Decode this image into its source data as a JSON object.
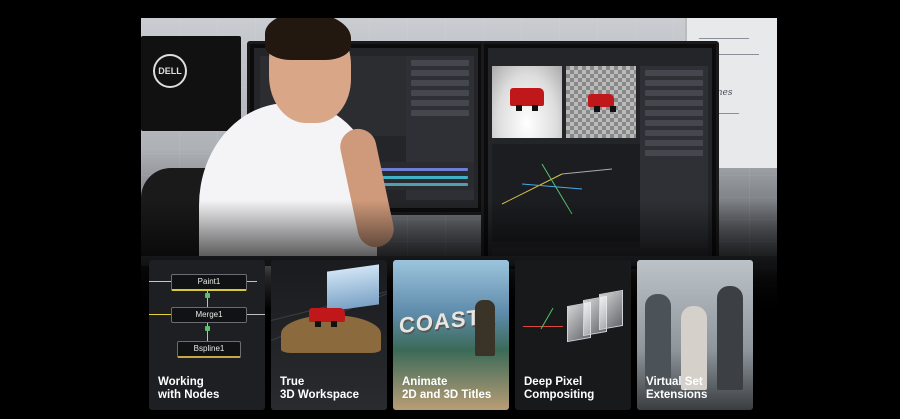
{
  "hero": {
    "monitor_brand": "DELL",
    "whiteboard_text": "frames"
  },
  "left_screen": {
    "title": ""
  },
  "cards": [
    {
      "label": "Working\nwith Nodes",
      "nodes": [
        "Paint1",
        "Merge1",
        "Bspline1"
      ]
    },
    {
      "label": "True\n3D Workspace"
    },
    {
      "label": "Animate\n2D and 3D Titles",
      "title_word": "COASTA"
    },
    {
      "label": "Deep Pixel\nCompositing"
    },
    {
      "label": "Virtual Set\nExtensions"
    }
  ],
  "colors": {
    "background": "#000000",
    "card_bg": "#1e1f22",
    "node_yellow": "#e6d33a",
    "node_blue": "#4aa9e6",
    "node_green": "#58c26b"
  }
}
